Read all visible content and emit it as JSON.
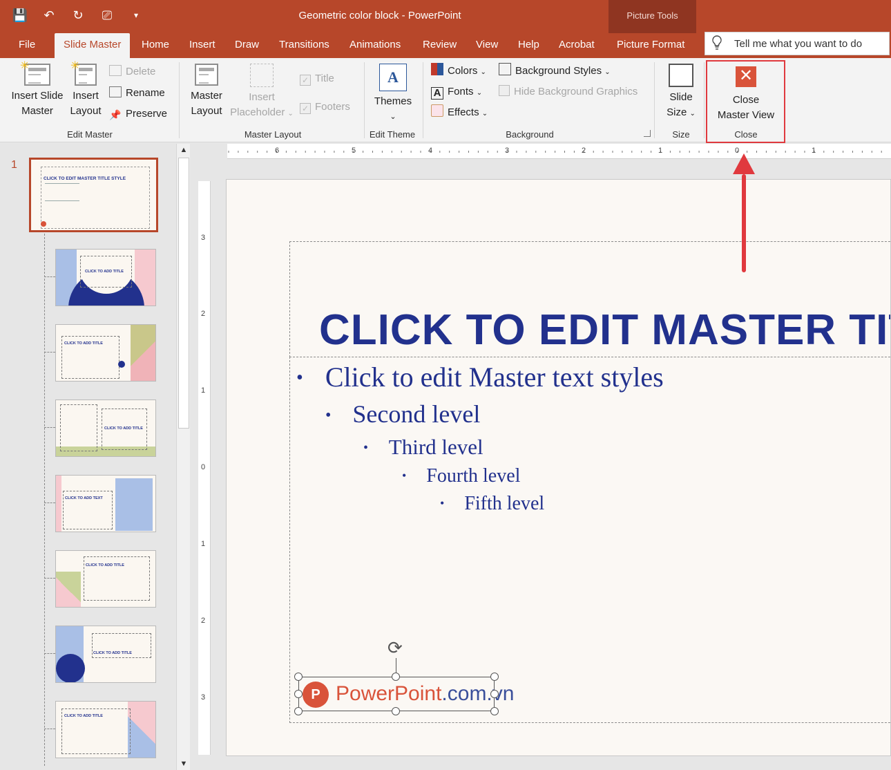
{
  "window": {
    "title": "Geometric color block  -  PowerPoint",
    "context_group": "Picture Tools"
  },
  "tabs": [
    "File",
    "Slide Master",
    "Home",
    "Insert",
    "Draw",
    "Transitions",
    "Animations",
    "Review",
    "View",
    "Help",
    "Acrobat",
    "Picture Format"
  ],
  "tell_me": {
    "placeholder": "Tell me what you want to do"
  },
  "ribbon": {
    "edit_master": {
      "label": "Edit Master",
      "insert_slide_master": [
        "Insert Slide",
        "Master"
      ],
      "insert_layout": [
        "Insert",
        "Layout"
      ],
      "delete": "Delete",
      "rename": "Rename",
      "preserve": "Preserve"
    },
    "master_layout": {
      "label": "Master Layout",
      "master_layout_btn": [
        "Master",
        "Layout"
      ],
      "insert_placeholder": [
        "Insert",
        "Placeholder"
      ],
      "title_cb": "Title",
      "footers_cb": "Footers"
    },
    "edit_theme": {
      "label": "Edit Theme",
      "themes": "Themes"
    },
    "background": {
      "label": "Background",
      "colors": "Colors",
      "fonts": "Fonts",
      "effects": "Effects",
      "background_styles": "Background Styles",
      "hide_bg_graphics": "Hide Background Graphics"
    },
    "size": {
      "label": "Size",
      "slide_size": [
        "Slide",
        "Size"
      ]
    },
    "close": {
      "label": "Close",
      "close_master_view": [
        "Close",
        "Master View"
      ]
    }
  },
  "thumbnails": {
    "slide_number": "1",
    "master_title": "CLICK TO EDIT MASTER TITLE STYLE",
    "layout_title": "CLICK TO ADD TITLE",
    "layout_text": "CLICK TO ADD TEXT"
  },
  "rulers": {
    "horizontal": [
      "6",
      "5",
      "4",
      "3",
      "2",
      "1",
      "0",
      "1"
    ],
    "vertical": [
      "3",
      "2",
      "1",
      "0",
      "1",
      "2",
      "3"
    ]
  },
  "slide": {
    "title": "CLICK TO EDIT MASTER TITLE STYLE",
    "levels": [
      "Click to edit Master text styles",
      "Second level",
      "Third level",
      "Fourth level",
      "Fifth level"
    ],
    "bullet": "•",
    "logo": {
      "brand": "PowerPoint",
      "domain": ".com.vn",
      "glyph": "P"
    }
  },
  "colors": {
    "accent": "#b7472a",
    "title_text": "#22318d",
    "logo_orange": "#d9533a",
    "logo_blue": "#3a4f9b",
    "highlight": "#e0393e"
  }
}
